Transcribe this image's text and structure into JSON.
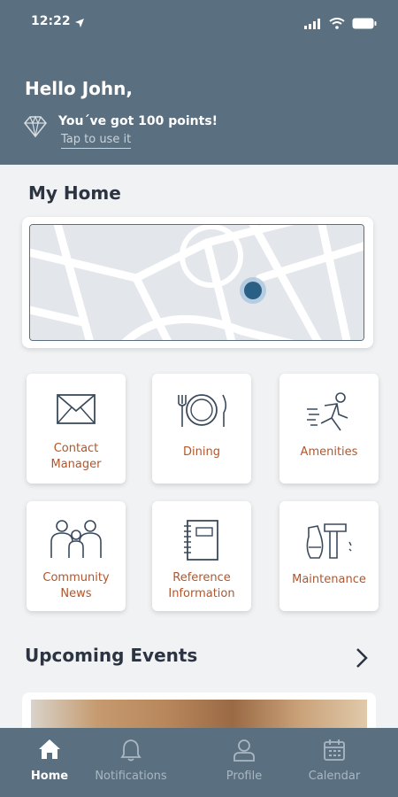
{
  "status_bar": {
    "time": "12:22"
  },
  "header": {
    "greeting": "Hello John,",
    "points_text": "You´ve got 100 points!",
    "points_link": "Tap to use it"
  },
  "my_home": {
    "title": "My Home"
  },
  "tiles": [
    {
      "label_1": "Contact",
      "label_2": "Manager",
      "icon": "envelope-icon"
    },
    {
      "label_1": "Dining",
      "icon": "plate-cutlery-icon"
    },
    {
      "label_1": "Amenities",
      "icon": "running-person-icon"
    },
    {
      "label_1": "Community",
      "label_2": "News",
      "icon": "family-icon"
    },
    {
      "label_1": "Reference",
      "label_2": "Information",
      "icon": "notebook-icon"
    },
    {
      "label_1": "Maintenance",
      "icon": "tools-icon"
    }
  ],
  "events": {
    "title": "Upcoming Events"
  },
  "tabbar": {
    "items": [
      {
        "label": "Home",
        "icon": "home-icon",
        "active": true
      },
      {
        "label": "Notifications",
        "icon": "bell-icon",
        "active": false
      },
      {
        "label": "Profile",
        "icon": "person-icon",
        "active": false
      },
      {
        "label": "Calendar",
        "icon": "calendar-icon",
        "active": false
      }
    ]
  },
  "colors": {
    "header": "#5a7080",
    "accent_text": "#b1562a",
    "map_pin": "#3c7ab0"
  }
}
